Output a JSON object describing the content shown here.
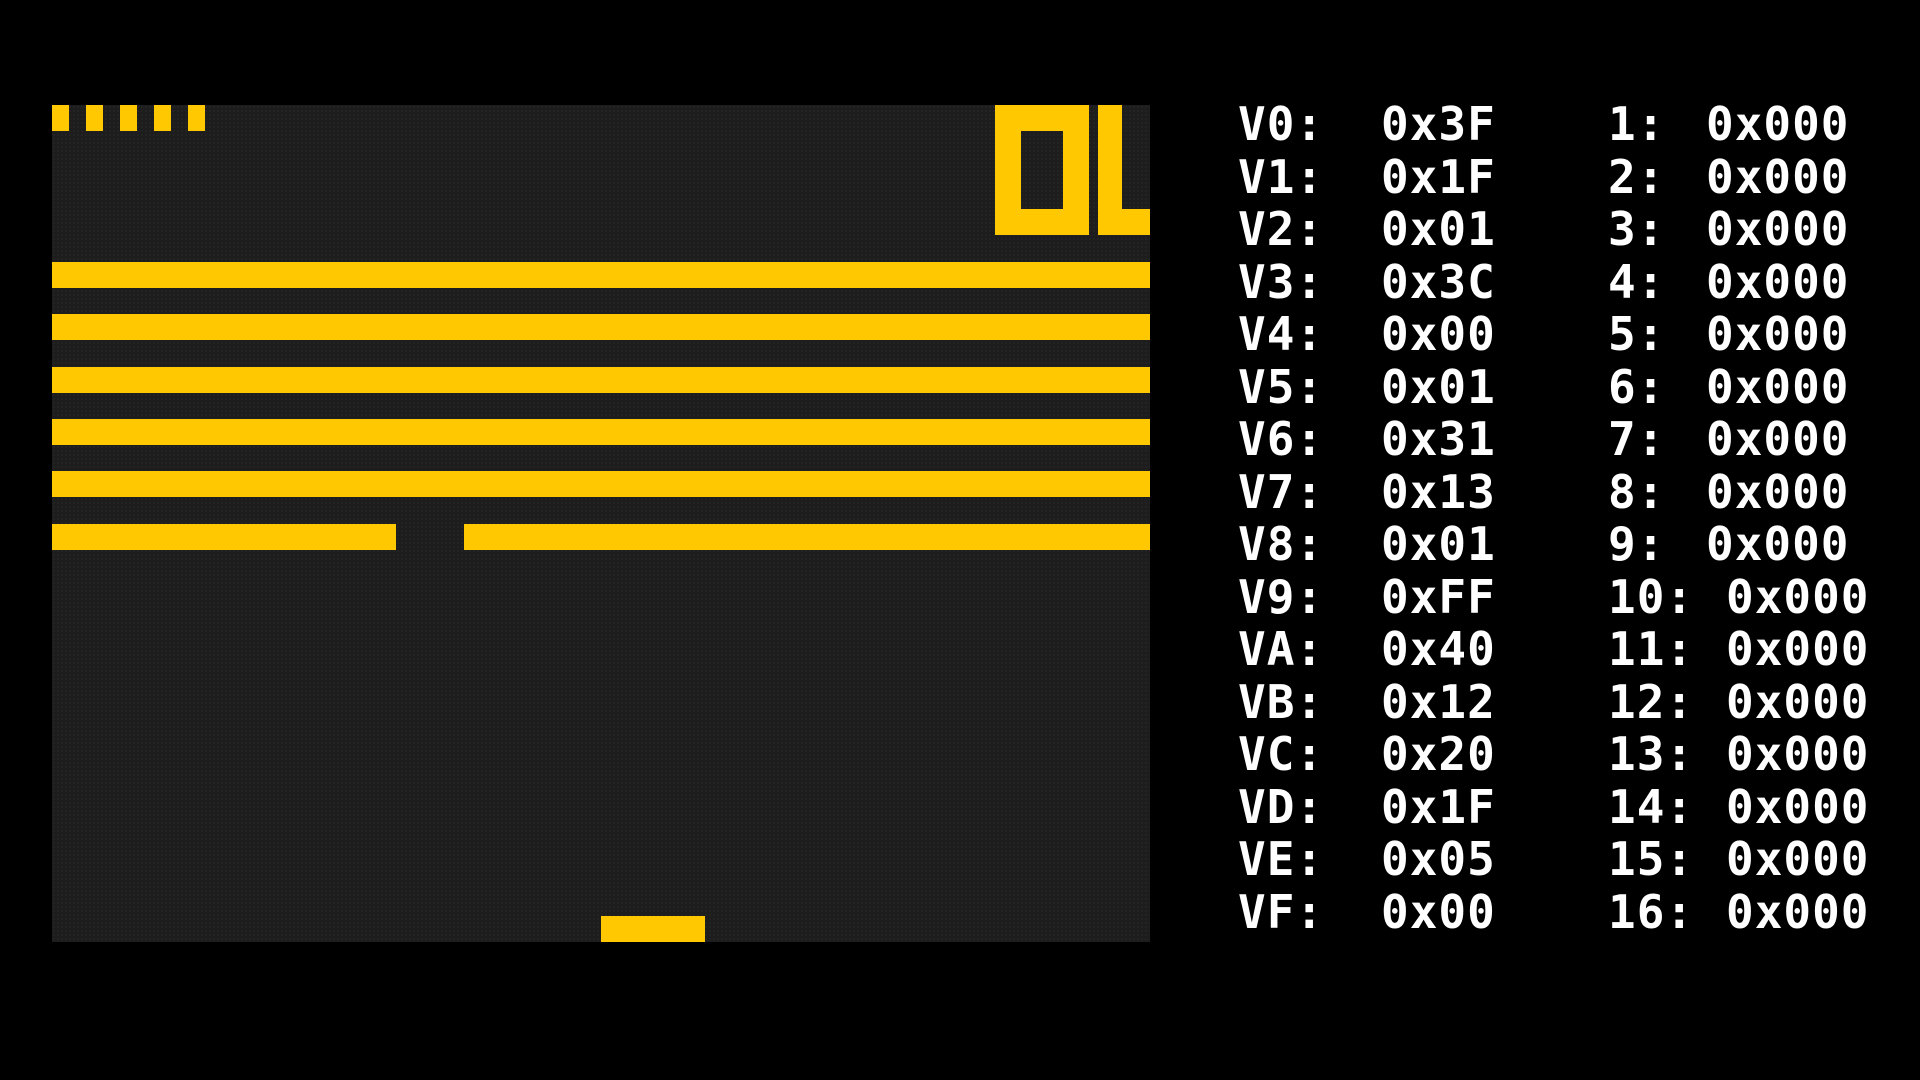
{
  "game": {
    "score": "01",
    "lives_remaining": 5,
    "colors": {
      "foreground": "#ffc800",
      "background": "#1d1d1d"
    }
  },
  "registers": [
    {
      "name": "V0:",
      "value": "0x3F"
    },
    {
      "name": "V1:",
      "value": "0x1F"
    },
    {
      "name": "V2:",
      "value": "0x01"
    },
    {
      "name": "V3:",
      "value": "0x3C"
    },
    {
      "name": "V4:",
      "value": "0x00"
    },
    {
      "name": "V5:",
      "value": "0x01"
    },
    {
      "name": "V6:",
      "value": "0x31"
    },
    {
      "name": "V7:",
      "value": "0x13"
    },
    {
      "name": "V8:",
      "value": "0x01"
    },
    {
      "name": "V9:",
      "value": "0xFF"
    },
    {
      "name": "VA:",
      "value": "0x40"
    },
    {
      "name": "VB:",
      "value": "0x12"
    },
    {
      "name": "VC:",
      "value": "0x20"
    },
    {
      "name": "VD:",
      "value": "0x1F"
    },
    {
      "name": "VE:",
      "value": "0x05"
    },
    {
      "name": "VF:",
      "value": "0x00"
    }
  ],
  "stack": [
    {
      "index": "1:",
      "value": "0x000"
    },
    {
      "index": "2:",
      "value": "0x000"
    },
    {
      "index": "3:",
      "value": "0x000"
    },
    {
      "index": "4:",
      "value": "0x000"
    },
    {
      "index": "5:",
      "value": "0x000"
    },
    {
      "index": "6:",
      "value": "0x000"
    },
    {
      "index": "7:",
      "value": "0x000"
    },
    {
      "index": "8:",
      "value": "0x000"
    },
    {
      "index": "9:",
      "value": "0x000"
    },
    {
      "index": "10:",
      "value": "0x000"
    },
    {
      "index": "11:",
      "value": "0x000"
    },
    {
      "index": "12:",
      "value": "0x000"
    },
    {
      "index": "13:",
      "value": "0x000"
    },
    {
      "index": "14:",
      "value": "0x000"
    },
    {
      "index": "15:",
      "value": "0x000"
    },
    {
      "index": "16:",
      "value": "0x000"
    }
  ]
}
